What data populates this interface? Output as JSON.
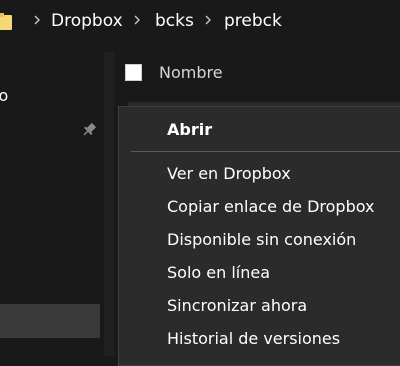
{
  "breadcrumb": {
    "items": [
      "Dropbox",
      "bcks",
      "prebck"
    ],
    "icon": "folder-icon",
    "separator_icon": "chevron-right-icon",
    "folder_color": "#f8d775"
  },
  "nav": {
    "visible_label": "lo",
    "pin_icon": "pin-icon"
  },
  "file_list": {
    "column_name": "Nombre"
  },
  "context_menu": {
    "items": [
      "Abrir",
      "Ver en Dropbox",
      "Copiar enlace de Dropbox",
      "Disponible sin conexión",
      "Solo en línea",
      "Sincronizar ahora",
      "Historial de versiones"
    ]
  },
  "colors": {
    "background": "#191919",
    "menu_background": "#2b2b2b",
    "text": "#ffffff"
  }
}
